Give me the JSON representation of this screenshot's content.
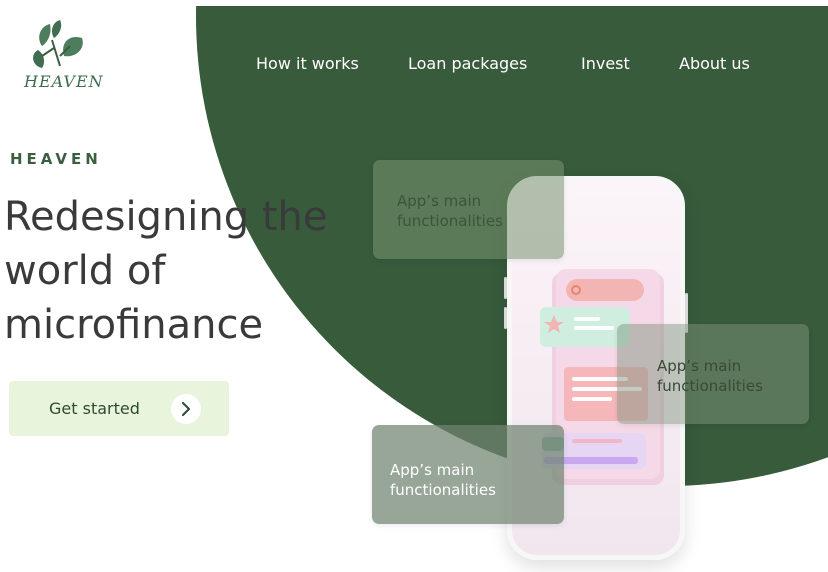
{
  "brand": {
    "logo_text": "HEAVEN",
    "eyebrow": "HEAVEN"
  },
  "nav": {
    "items": [
      "How it works",
      "Loan packages",
      "Invest",
      "About us"
    ]
  },
  "hero": {
    "headline_lines": [
      "Redesigning the",
      "world of",
      "microfinance"
    ],
    "cta_label": "Get started"
  },
  "cards": [
    {
      "text": "App’s main functionalities"
    },
    {
      "text": "App’s main functionalities"
    },
    {
      "text": "App’s main functionalities"
    }
  ],
  "colors": {
    "brand_green": "#385b3c",
    "cta_bg": "#e8f5dc",
    "text_dark": "#3a3a3a"
  },
  "icons": {
    "logo": "monstera-leaf-icon",
    "cta": "chevron-right-icon"
  }
}
